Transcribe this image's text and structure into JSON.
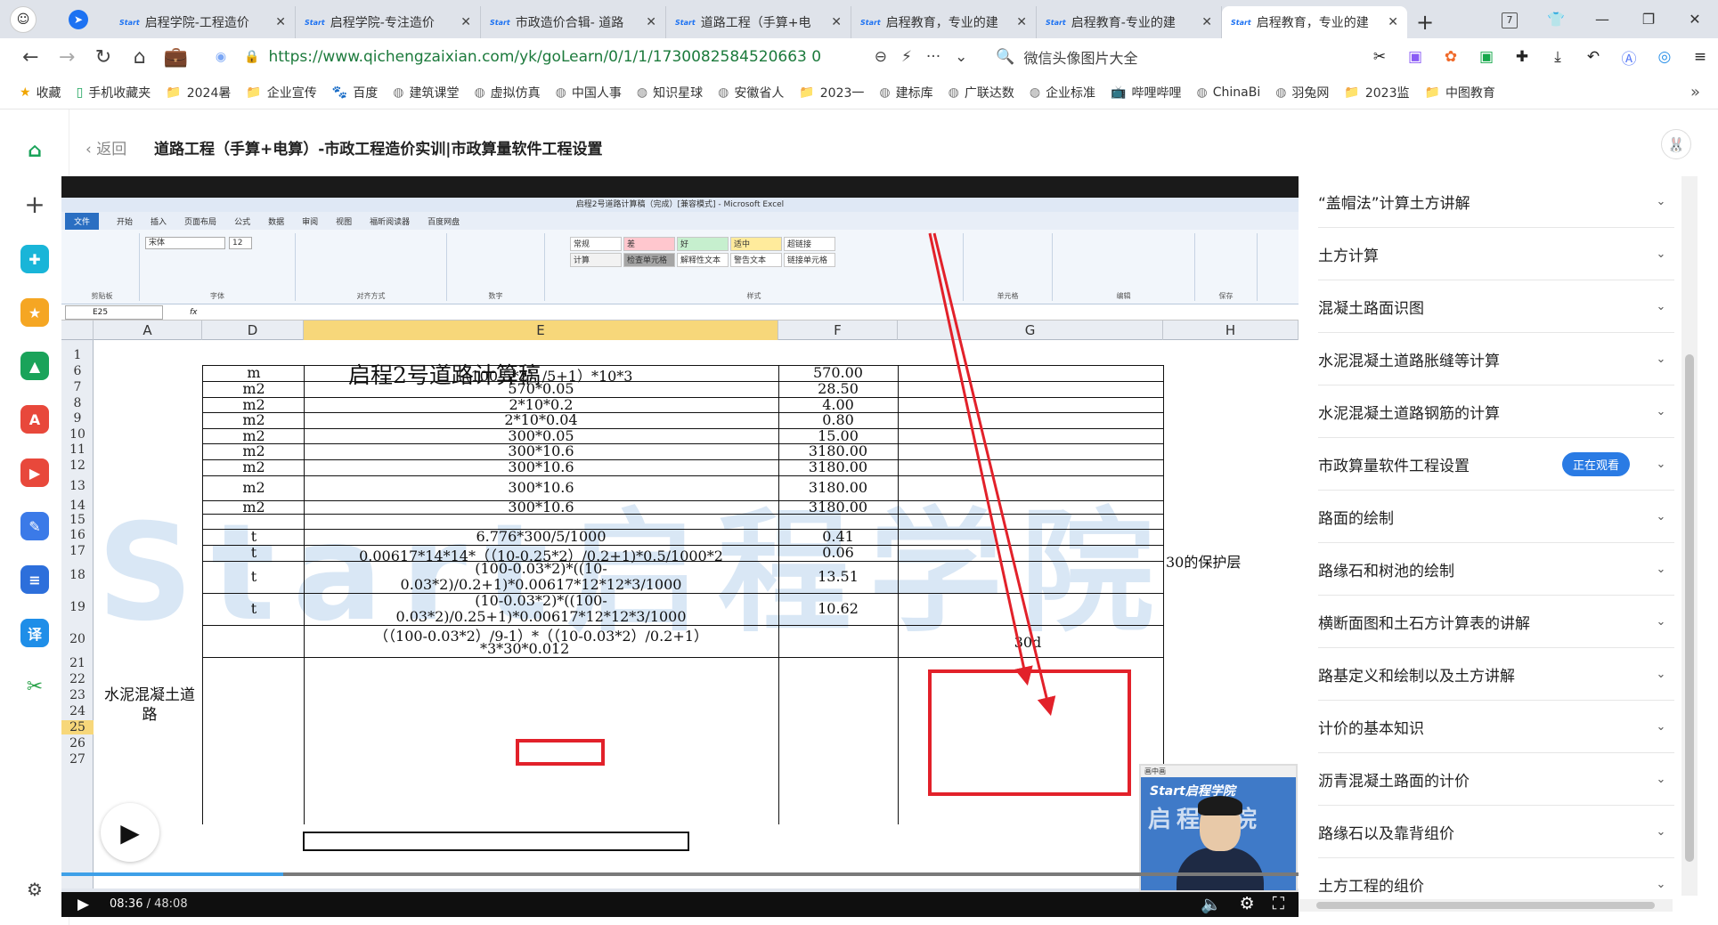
{
  "browser": {
    "tabs": [
      {
        "label": "启程学院-工程造价",
        "favicon": "Start",
        "active": false
      },
      {
        "label": "启程学院-专注造价",
        "favicon": "Start",
        "active": false
      },
      {
        "label": "市政造价合辑- 道路",
        "favicon": "Start",
        "active": false
      },
      {
        "label": "道路工程（手算+电",
        "favicon": "Start",
        "active": false
      },
      {
        "label": "启程教育，专业的建",
        "favicon": "Start",
        "active": false
      },
      {
        "label": "启程教育-专业的建",
        "favicon": "Start",
        "active": false
      },
      {
        "label": "启程教育，专业的建",
        "favicon": "Start",
        "active": true
      }
    ],
    "tab_count_badge": "7",
    "url": "https://www.qichengzaixian.com/yk/goLearn/0/1/1/1730082584520663 0",
    "search_text": "微信头像图片大全",
    "bookmarks": [
      {
        "label": "收藏",
        "icon": "star-icon"
      },
      {
        "label": "手机收藏夹",
        "icon": "phone-icon"
      },
      {
        "label": "2024暑",
        "icon": "folder-icon"
      },
      {
        "label": "企业宣传",
        "icon": "folder-icon"
      },
      {
        "label": "百度",
        "icon": "baidu-icon"
      },
      {
        "label": "建筑课堂",
        "icon": "site-icon"
      },
      {
        "label": "虚拟仿真",
        "icon": "site-icon"
      },
      {
        "label": "中国人事",
        "icon": "site-icon"
      },
      {
        "label": "知识星球",
        "icon": "site-icon"
      },
      {
        "label": "安徽省人",
        "icon": "site-icon"
      },
      {
        "label": "2023一",
        "icon": "folder-icon"
      },
      {
        "label": "建标库",
        "icon": "site-icon"
      },
      {
        "label": "广联达数",
        "icon": "site-icon"
      },
      {
        "label": "企业标准",
        "icon": "site-icon"
      },
      {
        "label": "哔哩哔哩",
        "icon": "bilibili-icon"
      },
      {
        "label": "ChinaBi",
        "icon": "site-icon"
      },
      {
        "label": "羽兔网",
        "icon": "site-icon"
      },
      {
        "label": "2023监",
        "icon": "folder-icon"
      },
      {
        "label": "中图教育",
        "icon": "folder-icon"
      }
    ]
  },
  "page": {
    "back_label": "返回",
    "title": "道路工程（手算+电算）-市政工程造价实训|市政算量软件工程设置"
  },
  "excel": {
    "window_title": "启程2号道路计算稿（完成）[兼容模式] - Microsoft Excel",
    "ribbon_tabs": [
      "文件",
      "开始",
      "插入",
      "页面布局",
      "公式",
      "数据",
      "审阅",
      "视图",
      "福昕阅读器",
      "百度网盘"
    ],
    "ribbon_groups": [
      "剪贴板",
      "字体",
      "对齐方式",
      "数字",
      "样式",
      "单元格",
      "编辑",
      "保存"
    ],
    "font_name": "宋体",
    "font_size": "12",
    "styles": [
      {
        "label": "常规",
        "color": "#ffffff"
      },
      {
        "label": "差",
        "color": "#ffc7ce"
      },
      {
        "label": "好",
        "color": "#c6efce"
      },
      {
        "label": "适中",
        "color": "#ffeb9c"
      },
      {
        "label": "超链接",
        "color": "#ffffff"
      },
      {
        "label": "计算",
        "color": "#f2f2f2"
      },
      {
        "label": "检查单元格",
        "color": "#a5a5a5"
      },
      {
        "label": "解释性文本",
        "color": "#ffffff"
      },
      {
        "label": "警告文本",
        "color": "#ffffff"
      },
      {
        "label": "链接单元格",
        "color": "#ffffff"
      }
    ],
    "name_box": "E25",
    "columns": [
      "A",
      "D",
      "E",
      "F",
      "G",
      "H"
    ],
    "sheet_title": "启程2号道路计算稿",
    "category_label": "水泥混凝土道路",
    "rows": [
      {
        "row": "1"
      },
      {
        "row": "6",
        "unit": "m",
        "formula": "（（100-5*2）/5+1）*10*3",
        "value": "570.00"
      },
      {
        "row": "7",
        "unit": "m2",
        "formula": "570*0.05",
        "value": "28.50"
      },
      {
        "row": "8",
        "unit": "m2",
        "formula": "2*10*0.2",
        "value": "4.00"
      },
      {
        "row": "9",
        "unit": "m2",
        "formula": "2*10*0.04",
        "value": "0.80"
      },
      {
        "row": "10",
        "unit": "m2",
        "formula": "300*0.05",
        "value": "15.00"
      },
      {
        "row": "11",
        "unit": "m2",
        "formula": "300*10.6",
        "value": "3180.00"
      },
      {
        "row": "12",
        "unit": "m2",
        "formula": "300*10.6",
        "value": "3180.00"
      },
      {
        "row": "13",
        "unit": "m2",
        "formula": "300*10.6",
        "value": "3180.00"
      },
      {
        "row": "14",
        "unit": "m2",
        "formula": "300*10.6",
        "value": "3180.00"
      },
      {
        "row": "15"
      },
      {
        "row": "16",
        "unit": "t",
        "formula": "6.776*300/5/1000",
        "value": "0.41"
      },
      {
        "row": "17",
        "unit": "t",
        "formula": "0.00617*14*14*（（10-0.25*2）/0.2+1)*0.5/1000*2",
        "value": "0.06"
      },
      {
        "row": "18",
        "unit": "t",
        "formula": "(100-0.03*2)*((10-",
        "formula2": "0.03*2)/0.2+1)*0.00617*12*12*3/1000",
        "value": "13.51",
        "note": "30的保护层"
      },
      {
        "row": "19",
        "unit": "t",
        "formula": "(10-0.03*2)*((100-",
        "formula2": "0.03*2)/0.25+1)*0.00617*12*12*3/1000",
        "value": "10.62"
      },
      {
        "row": "20",
        "formula": "（（100-0.03*2）/9-1）*（（10-0.03*2）/0.2+1）",
        "formula2_prefix": "*3*",
        "formula2_highlight": "30*0.012",
        "g_value": "30d"
      },
      {
        "row": "21"
      },
      {
        "row": "22"
      },
      {
        "row": "23"
      },
      {
        "row": "24"
      },
      {
        "row": "25"
      },
      {
        "row": "26"
      },
      {
        "row": "27"
      }
    ],
    "watermark": "Start启程学院"
  },
  "video": {
    "current_time": "08:36",
    "duration": "48:08",
    "progress": 0.179,
    "pip_window_title": "画中画",
    "pip_brand": "Start启程学院",
    "pip_big": "启程学院"
  },
  "playlist": {
    "items": [
      {
        "label": "“盖帽法”计算土方讲解",
        "watching": false
      },
      {
        "label": "土方计算",
        "watching": false
      },
      {
        "label": "混凝土路面识图",
        "watching": false
      },
      {
        "label": "水泥混凝土道路胀缝等计算",
        "watching": false
      },
      {
        "label": "水泥混凝土道路钢筋的计算",
        "watching": false
      },
      {
        "label": "市政算量软件工程设置",
        "watching": true
      },
      {
        "label": "路面的绘制",
        "watching": false
      },
      {
        "label": "路缘石和树池的绘制",
        "watching": false
      },
      {
        "label": "横断面图和土石方计算表的讲解",
        "watching": false
      },
      {
        "label": "路基定义和绘制以及土方讲解",
        "watching": false
      },
      {
        "label": "计价的基本知识",
        "watching": false
      },
      {
        "label": "沥青混凝土路面的计价",
        "watching": false
      },
      {
        "label": "路缘石以及靠背组价",
        "watching": false
      },
      {
        "label": "土方工程的组价",
        "watching": false
      }
    ],
    "watching_label": "正在观看"
  }
}
